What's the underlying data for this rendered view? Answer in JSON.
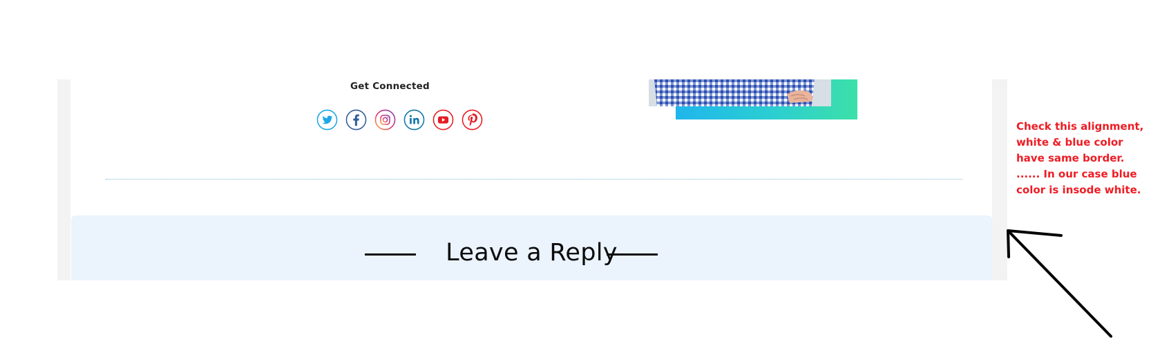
{
  "section": {
    "heading": "Get Connected"
  },
  "social_links": [
    {
      "name": "twitter",
      "icon": "twitter-icon",
      "color": "#1da1f2"
    },
    {
      "name": "facebook",
      "icon": "facebook-icon",
      "color": "#3b5998"
    },
    {
      "name": "instagram",
      "icon": "instagram-icon",
      "color": "#e4405f"
    },
    {
      "name": "linkedin",
      "icon": "linkedin-icon",
      "color": "#0077b5"
    },
    {
      "name": "youtube",
      "icon": "youtube-icon",
      "color": "#ff0000"
    },
    {
      "name": "pinterest",
      "icon": "pinterest-icon",
      "color": "#e60023"
    }
  ],
  "reply": {
    "heading": "Leave a Reply",
    "background": "#ebf3fd"
  },
  "annotation": {
    "lines": [
      "Check this alignment,",
      "white & blue color",
      "have same border.",
      "...... In our case blue",
      "color is insode white."
    ],
    "color": "#ee1c24",
    "arrow_color": "#000000"
  }
}
